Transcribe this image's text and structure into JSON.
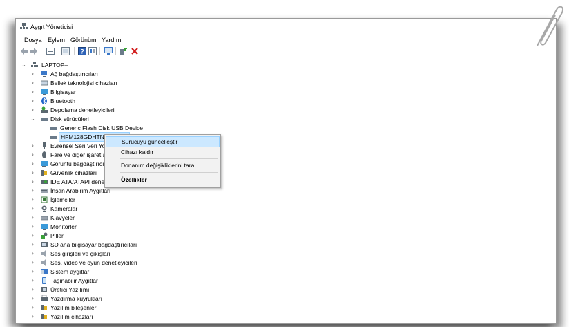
{
  "window": {
    "title": "Aygıt Yöneticisi"
  },
  "menu": [
    "Dosya",
    "Eylem",
    "Görünüm",
    "Yardım"
  ],
  "toolbar": {
    "icons": [
      "back-arrow-icon",
      "forward-arrow-icon",
      "device-view-icon",
      "list-view-icon",
      "help-icon",
      "properties-icon",
      "monitor-scan-icon",
      "add-driver-icon",
      "remove-device-icon"
    ]
  },
  "tree": {
    "root": "LAPTOP–",
    "categories": [
      "Ağ bağdaştırıcıları",
      "Bellek teknolojisi cihazları",
      "Bilgisayar",
      "Bluetooth",
      "Depolama denetleyicileri",
      "Disk sürücüleri",
      "Generic Flash Disk USB Device",
      "HFM128GDHTNG-8310A",
      "Evrensel Seri Veri Yolu denetleyicileri",
      "Fare ve diğer işaret aygıtları",
      "Görüntü bağdaştırıcıları",
      "Güvenlik cihazları",
      "IDE ATA/ATAPI denetleyicileri",
      "İnsan Arabirim Aygıtları",
      "İşlemciler",
      "Kameralar",
      "Klavyeler",
      "Monitörler",
      "Piller",
      "SD ana bilgisayar bağdaştırıcıları",
      "Ses girişleri ve çıkışları",
      "Ses, video ve oyun denetleyicileri",
      "Sistem aygıtları",
      "Taşınabilir Aygıtlar",
      "Üretici Yazılımı",
      "Yazdırma kuyrukları",
      "Yazılım bileşenleri",
      "Yazılım cihazları"
    ]
  },
  "context_menu": {
    "update": "Sürücüyü güncelleştir",
    "remove": "Cihazı kaldır",
    "scan": "Donanım değişikliklerini tara",
    "properties": "Özellikler"
  }
}
